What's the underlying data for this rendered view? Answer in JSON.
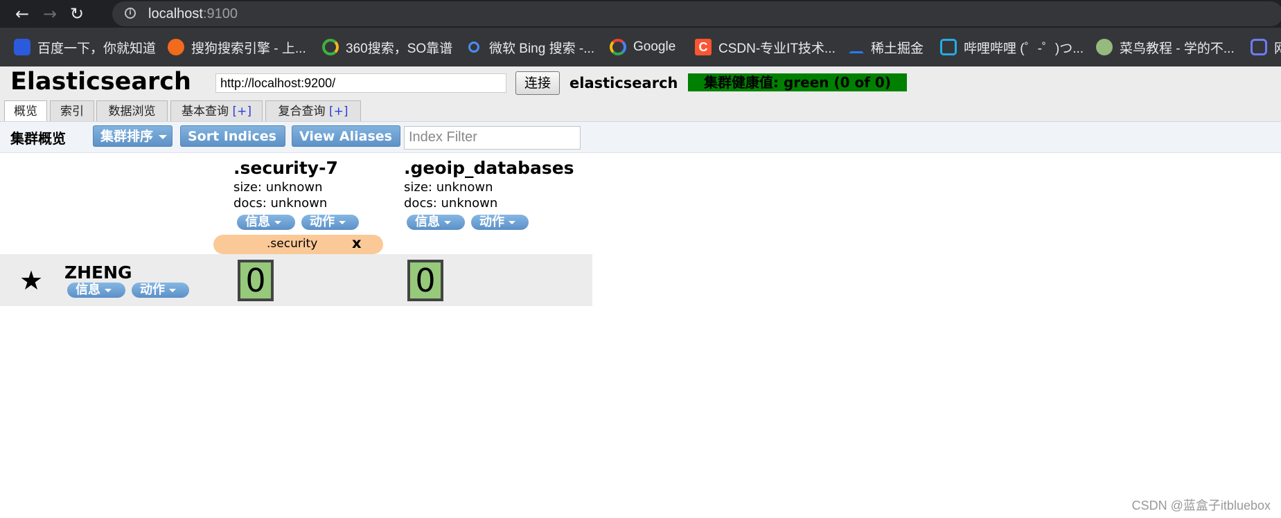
{
  "browser": {
    "address_host": "localhost",
    "address_port": ":9100",
    "bookmarks": [
      "百度一下，你就知道",
      "搜狗搜索引擎 - 上...",
      "360搜索，SO靠谱",
      "微软 Bing 搜索 -...",
      "Google",
      "CSDN-专业IT技术...",
      "稀土掘金",
      "哔哩哔哩 (゜-゜)つ...",
      "菜鸟教程 - 学的不...",
      "网"
    ]
  },
  "header": {
    "logo": "Elasticsearch",
    "url_value": "http://localhost:9200/",
    "connect_label": "连接",
    "cluster_name": "elasticsearch",
    "health_text": "集群健康值: green (0 of 0)",
    "health_color": "#008000"
  },
  "tabs": {
    "overview": "概览",
    "indices": "索引",
    "browser": "数据浏览",
    "basic_query": "基本查询",
    "complex_query": "复合查询",
    "plus": "[+]"
  },
  "toolbar": {
    "title": "集群概览",
    "sort_cluster": "集群排序",
    "sort_indices": "Sort Indices",
    "view_aliases": "View Aliases",
    "filter_placeholder": "Index Filter"
  },
  "indices": [
    {
      "name": ".security-7",
      "size": "size: unknown",
      "docs": "docs: unknown",
      "info": "信息",
      "action": "动作"
    },
    {
      "name": ".geoip_databases",
      "size": "size: unknown",
      "docs": "docs: unknown",
      "info": "信息",
      "action": "动作"
    }
  ],
  "alias": {
    "label": ".security",
    "remove": "x"
  },
  "node": {
    "name": "ZHENG",
    "info": "信息",
    "action": "动作",
    "shards": [
      "0",
      "0"
    ]
  },
  "watermark": "CSDN @蓝盒子itbluebox"
}
